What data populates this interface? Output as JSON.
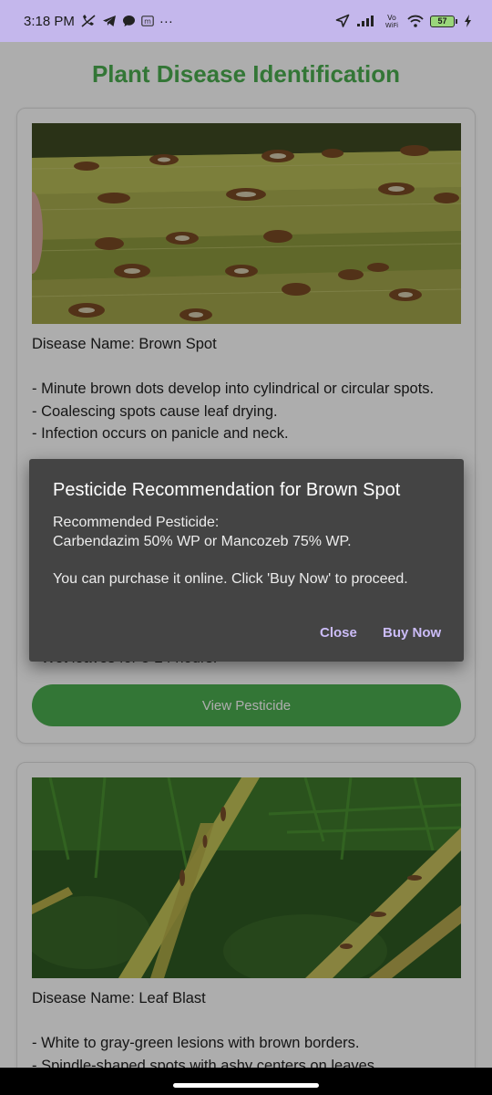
{
  "status_bar": {
    "time": "3:18 PM",
    "left_icons": [
      "muted-call-icon",
      "telegram-icon",
      "chat-icon",
      "m-badge-icon",
      "more-dots-icon"
    ],
    "right_icons": [
      "location-arrow-icon",
      "signal-icon",
      "vowifi-icon",
      "wifi-icon"
    ],
    "vowifi_text": "Vo\nWiFi",
    "battery": "57",
    "dots": "···"
  },
  "page": {
    "title": "Plant Disease Identification"
  },
  "cards": [
    {
      "image": "brown-spot-leaf-photo",
      "text": "Disease Name: Brown Spot\n\n- Minute brown dots develop into cylindrical or circular spots.\n- Coalescing spots cause leaf drying.\n- Infection occurs on panicle and neck.",
      "partial_line": "- Wet leaves for 8-24 hours.",
      "button_label": "View Pesticide"
    },
    {
      "image": "leaf-blast-photo",
      "text": "Disease Name: Leaf Blast\n\n- White to gray-green lesions with brown borders.\n- Spindle-shaped spots with ashy centers on leaves."
    }
  ],
  "dialog": {
    "title": "Pesticide Recommendation for Brown Spot",
    "body": "Recommended Pesticide:\nCarbendazim 50% WP or Mancozeb 75% WP.\n\nYou can purchase it online. Click 'Buy Now' to proceed.",
    "close_label": "Close",
    "buy_label": "Buy Now"
  },
  "colors": {
    "status_bar": "#c4b7ec",
    "title_green": "#4caf50",
    "button_green": "#4caf50",
    "dialog_bg": "#444444",
    "dialog_action": "#cbbcf7"
  }
}
